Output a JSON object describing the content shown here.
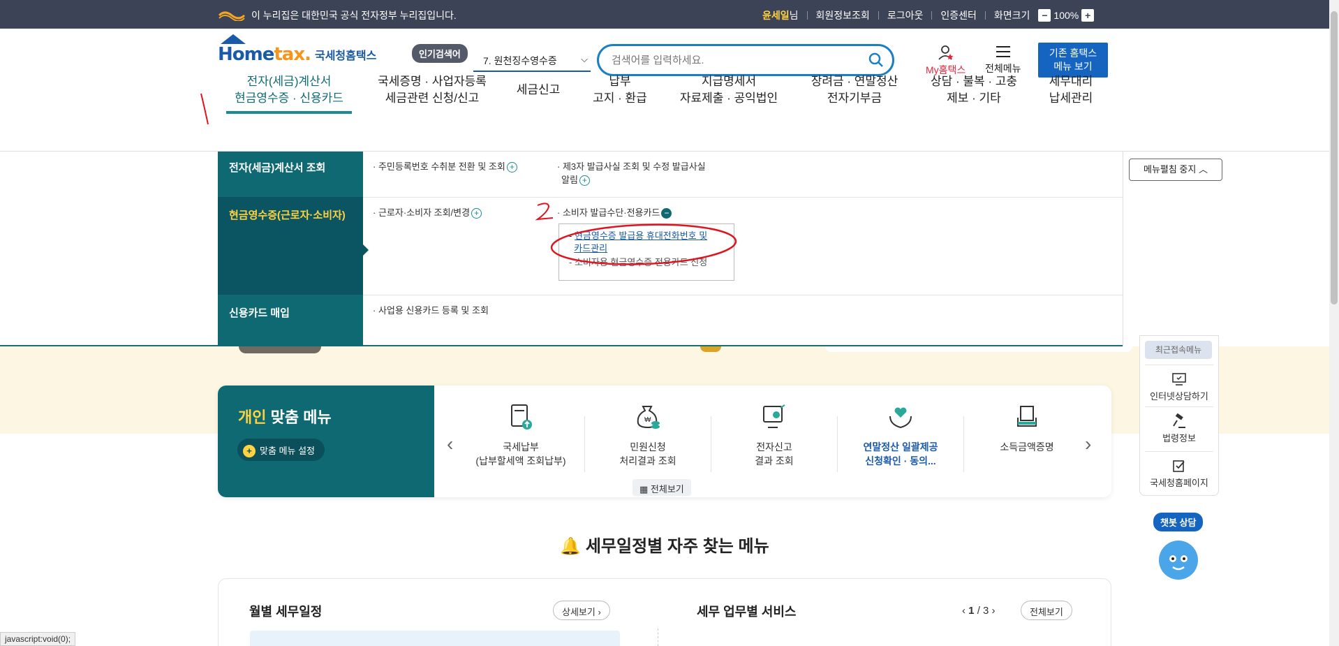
{
  "topbar": {
    "notice": "이 누리집은 대한민국 공식 전자정부 누리집입니다.",
    "user_name": "윤세일",
    "user_suffix": "님",
    "links": [
      "회원정보조회",
      "로그아웃",
      "인증센터",
      "화면크기"
    ],
    "zoom": "100%"
  },
  "header": {
    "logo_text_home": "Home",
    "logo_text_tax": "tax.",
    "logo_text_kr": "국세청홈택스",
    "popular_label": "인기검색어",
    "popular_item": "7.  원천징수영수증",
    "search_placeholder": "검색어를 입력하세요.",
    "mytax_label": "My홈택스",
    "allmenu_label": "전체메뉴",
    "old_site_line1": "기존 홈택스",
    "old_site_line2": "메뉴 보기"
  },
  "gnb": [
    {
      "line1": "전자(세금)계산서",
      "line2": "현금영수증 · 신용카드"
    },
    {
      "line1": "국세증명 · 사업자등록",
      "line2": "세금관련 신청/신고"
    },
    {
      "line1": "세금신고",
      "line2": ""
    },
    {
      "line1": "납부",
      "line2": "고지 · 환급"
    },
    {
      "line1": "지급명세서",
      "line2": "자료제출 · 공익법인"
    },
    {
      "line1": "장려금 · 연말정산",
      "line2": "전자기부금"
    },
    {
      "line1": "상담 · 불복 · 고충",
      "line2": "제보 · 기타"
    },
    {
      "line1": "세무대리",
      "line2": "납세관리"
    }
  ],
  "mega": {
    "cat1": "전자(세금)계산서 조회",
    "cat2": "현금영수증(근로자·소비자)",
    "cat3": "신용카드 매입",
    "r1_link1": "· 주민등록번호 수취분 전환 및 조회",
    "r1_link2a": "· 제3자 발급사실 조회 및 수정 발급사실",
    "r1_link2b": "알림",
    "r2_link1": "· 근로자·소비자 조회/변경",
    "r2_link2": "· 소비자 발급수단·전용카드",
    "sub1a": "현금영수증 발급용 휴대전화번호 및",
    "sub1b": "카드관리",
    "sub2": "소비자용 현금영수증 전용카드 신청",
    "r3_link1": "· 사업용 신용카드 등록 및 조회",
    "stop_btn": "메뉴펼침 중지"
  },
  "quick": {
    "top": "최근접속메뉴",
    "items": [
      "인터넷상담하기",
      "법령정보",
      "국세청홈페이지"
    ]
  },
  "personal": {
    "title_y": "개인",
    "title_rest": " 맞춤 메뉴",
    "setting": "맞춤 메뉴 설정",
    "items": [
      {
        "l1": "국세납부",
        "l2": "(납부할세액 조회납부)"
      },
      {
        "l1": "민원신청",
        "l2": "처리결과 조회"
      },
      {
        "l1": "전자신고",
        "l2": "결과 조회"
      },
      {
        "l1": "연말정산 일괄제공",
        "l2": "신청확인 · 동의..."
      },
      {
        "l1": "소득금액증명",
        "l2": ""
      }
    ],
    "view_all": "전체보기"
  },
  "schedule": {
    "title": "세무일정별 자주 찾는 메뉴",
    "monthly": "월별 세무일정",
    "detail": "상세보기",
    "service": "세무 업무별 서비스",
    "page_current": "1",
    "page_total": "/ 3",
    "view_all": "전체보기"
  },
  "chatbot": "챗봇 상담",
  "statusbar": "javascript:void(0);",
  "annotations": {
    "mark1": "1",
    "mark2": "2"
  },
  "colors": {
    "teal": "#0e6973",
    "accent_yellow": "#ffd23f",
    "brand_blue": "#1565c0",
    "annotation_red": "#e0141e"
  }
}
